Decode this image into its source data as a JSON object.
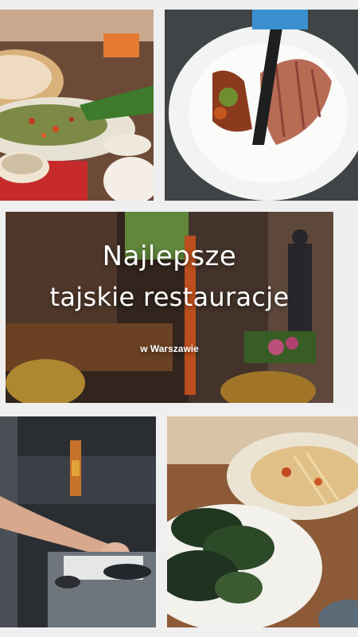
{
  "hero": {
    "title_line1": "Najlepsze",
    "title_line2": "tajskie restauracje",
    "subtitle": "w Warszawie"
  },
  "photos": [
    {
      "name": "thai-dishes-table-photo"
    },
    {
      "name": "sliced-duck-plate-photo"
    },
    {
      "name": "street-restaurant-photo"
    },
    {
      "name": "chef-cooking-photo"
    },
    {
      "name": "mussels-salad-photo"
    }
  ],
  "colors": {
    "background": "#efefef",
    "title_text": "#ffffff"
  }
}
